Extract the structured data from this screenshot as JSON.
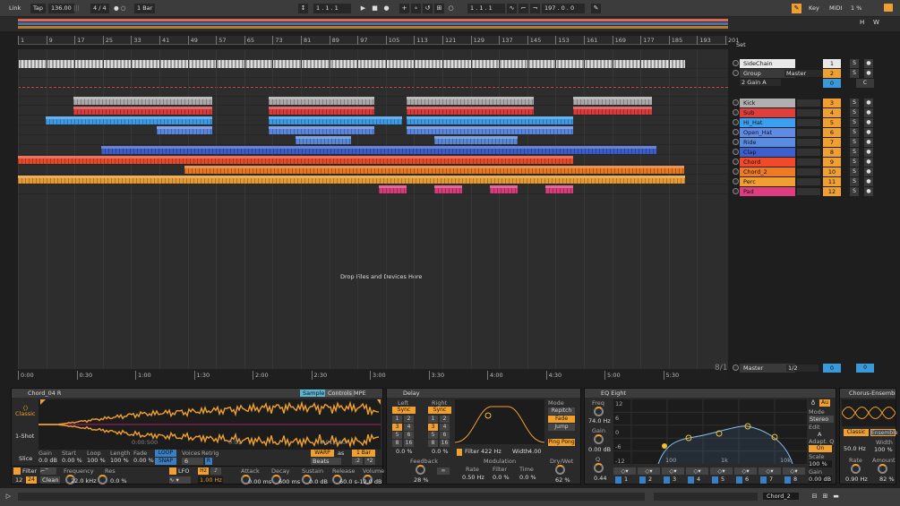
{
  "control_bar": {
    "link": "Link",
    "tap": "Tap",
    "tempo": "136.00",
    "meter": "4 / 4",
    "quant": "1 Bar",
    "position": "1 .  1 .  1",
    "loop_start": "1 .  1 .  1",
    "loop_len": "197 .  0 .  0",
    "key": "Key",
    "midi": "MIDI",
    "cpu": "1 %",
    "h": "H",
    "w": "W",
    "dots": "● ○"
  },
  "beat_ruler": [
    "1",
    "9",
    "17",
    "25",
    "33",
    "41",
    "49",
    "57",
    "65",
    "73",
    "81",
    "89",
    "97",
    "105",
    "113",
    "121",
    "129",
    "137",
    "145",
    "153",
    "161",
    "169",
    "177",
    "185",
    "193",
    "201"
  ],
  "time_ruler": [
    "0:00",
    "0:30",
    "1:00",
    "1:30",
    "2:00",
    "2:30",
    "3:00",
    "3:30",
    "4:00",
    "4:30",
    "5:00",
    "5:30"
  ],
  "drop_text": "Drop Files and Devices Here",
  "ratio": "8/1",
  "set_label": "Set",
  "mixer": {
    "sidechain": {
      "name": "SideChain",
      "num": "1"
    },
    "group": {
      "name": "Group",
      "output": "Master",
      "num": "2",
      "gain_a": "2 Gain A",
      "vol": "0",
      "c": "C"
    },
    "tracks": [
      {
        "name": "Kick",
        "num": "3",
        "color": "#b0b0b0"
      },
      {
        "name": "Sub",
        "num": "4",
        "color": "#e03d3d"
      },
      {
        "name": "Hi_Hat",
        "num": "5",
        "color": "#3d9ff0"
      },
      {
        "name": "Open_Hat",
        "num": "6",
        "color": "#5f8ae8"
      },
      {
        "name": "Ride",
        "num": "7",
        "color": "#5a8de0"
      },
      {
        "name": "Clap",
        "num": "8",
        "color": "#3d5fd0"
      },
      {
        "name": "Chord",
        "num": "9",
        "color": "#f04a2a"
      },
      {
        "name": "Chord_2",
        "num": "10",
        "color": "#f07a20"
      },
      {
        "name": "Perc",
        "num": "11",
        "color": "#f0a030"
      },
      {
        "name": "Pad",
        "num": "12",
        "color": "#e03d80"
      }
    ],
    "s": "S",
    "master": {
      "name": "Master",
      "route": "1/2",
      "v1": "0",
      "v2": "0"
    }
  },
  "simpler": {
    "title": "Chord_04 R",
    "tabs": [
      "Sample",
      "Controls"
    ],
    "mpe": "MPE",
    "modes": [
      "Classic",
      "1-Shot",
      "Slice"
    ],
    "gain_l": "Gain",
    "gain_v": "0.0 dB",
    "start_l": "Start",
    "start_v": "0.00 %",
    "loop_l": "Loop",
    "loop_v": "100 %",
    "length_l": "Length",
    "length_v": "100 %",
    "fade_l": "Fade",
    "fade_v": "0.00 %",
    "loop_btn": "LOOP",
    "snap_btn": "SNAP",
    "voices_l": "Voices",
    "voices_v": "6",
    "retrig_l": "Retrig",
    "retrig_v": "R",
    "warp": "WARP",
    "as": "as",
    "bar": "1 Bar",
    "beats": "Beats",
    "half": ":2",
    "dbl": "*2",
    "t1": "0:00:500",
    "t2": "0:01",
    "t3": "0:01:500",
    "filter": "Filter",
    "f12": "12",
    "f24": "24",
    "clean": "Clean",
    "freq_l": "Frequency",
    "freq_v": "22.0 kHz",
    "res_l": "Res",
    "res_v": "0.0 %",
    "lfo": "LFO",
    "hz": "Hz",
    "lfo_rate": "1.00 Hz",
    "attack_l": "Attack",
    "attack_v": "0.00 ms",
    "decay_l": "Decay",
    "decay_v": "600 ms",
    "sustain_l": "Sustain",
    "sustain_v": "0.0 dB",
    "release_l": "Release",
    "release_v": "60.0 s",
    "volume_l": "Volume",
    "volume_v": "-12.0 dB"
  },
  "delay": {
    "title": "Delay",
    "left": "Left",
    "right": "Right",
    "sync": "Sync",
    "grid": [
      "1",
      "2",
      "3",
      "4",
      "5",
      "6",
      "8",
      "16"
    ],
    "pct": "0.0 %",
    "feedback_l": "Feedback",
    "feedback_v": "28 %",
    "filter_l": "Filter",
    "filter_v": "422 Hz",
    "width_l": "Width",
    "width_v": "4.00",
    "modulation": "Modulation",
    "rate_l": "Rate",
    "rate_v": "0.50 Hz",
    "mfilter_l": "Filter",
    "mfilter_v": "0.0 %",
    "time_l": "Time",
    "time_v": "0.0 %",
    "mode_l": "Mode",
    "modes": [
      "Repitch",
      "Fade",
      "Jump"
    ],
    "pingpong": "Ping Pong",
    "drywet_l": "Dry/Wet",
    "drywet_v": "62 %",
    "inf": "∞"
  },
  "eq": {
    "title": "EQ Eight",
    "freq_l": "Freq",
    "freq_v": "74.0 Hz",
    "gain_l": "Gain",
    "gain_v": "0.00 dB",
    "q_l": "Q",
    "q_v": "0.44",
    "y": [
      "12",
      "6",
      "0",
      "-6",
      "-12"
    ],
    "x": [
      "100",
      "1k",
      "10k"
    ],
    "mode_l": "Mode",
    "mode_v": "Stereo",
    "edit_l": "Edit",
    "edit_v": "A",
    "adapt_l": "Adapt. Q",
    "on": "On",
    "scale_l": "Scale",
    "scale_v": "100 %",
    "gain2_l": "Gain",
    "gain2_v": "0.00 dB",
    "bands": [
      "1",
      "2",
      "3",
      "4",
      "5",
      "6",
      "7",
      "8"
    ],
    "au": "Au"
  },
  "chorus": {
    "title": "Chorus-Ensemble",
    "classic": "Classic",
    "ensemble": "Ensemble",
    "freq": "50.0 Hz",
    "width_l": "Width",
    "width_v": "100 %",
    "rate_l": "Rate",
    "rate_v": "0.90 Hz",
    "amount_l": "Amount",
    "amount_v": "82 %"
  },
  "status": {
    "track": "Chord_2"
  }
}
